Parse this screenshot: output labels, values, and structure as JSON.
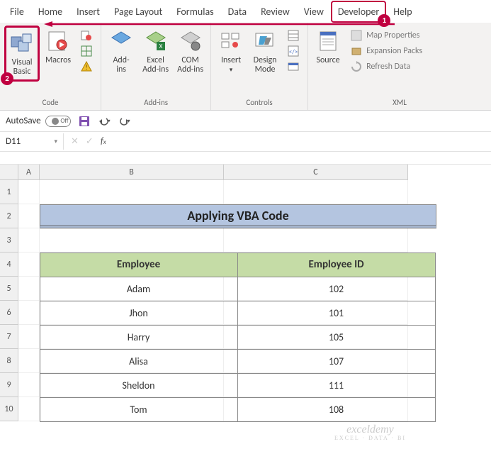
{
  "tabs": [
    "File",
    "Home",
    "Insert",
    "Page Layout",
    "Formulas",
    "Data",
    "Review",
    "View",
    "Developer",
    "Help"
  ],
  "active_tab": "Developer",
  "callouts": {
    "badge1": "1",
    "badge2": "2"
  },
  "ribbon": {
    "code": {
      "label": "Code",
      "visual_basic": "Visual\nBasic",
      "macros": "Macros"
    },
    "addins": {
      "label": "Add-ins",
      "addins": "Add-\nins",
      "excel_addins": "Excel\nAdd-ins",
      "com_addins": "COM\nAdd-ins"
    },
    "controls": {
      "label": "Controls",
      "insert": "Insert",
      "design_mode": "Design\nMode"
    },
    "xml": {
      "label": "XML",
      "source": "Source",
      "map_properties": "Map Properties",
      "expansion_packs": "Expansion Packs",
      "refresh_data": "Refresh Data"
    }
  },
  "qat": {
    "autosave_label": "AutoSave",
    "autosave_state": "Off"
  },
  "name_box": "D11",
  "formula_bar": "",
  "columns": [
    "A",
    "B",
    "C"
  ],
  "rows": [
    "1",
    "2",
    "3",
    "4",
    "5",
    "6",
    "7",
    "8",
    "9",
    "10"
  ],
  "title": "Applying VBA Code",
  "table": {
    "headers": [
      "Employee",
      "Employee ID"
    ],
    "data": [
      [
        "Adam",
        "102"
      ],
      [
        "Jhon",
        "101"
      ],
      [
        "Harry",
        "105"
      ],
      [
        "Alisa",
        "107"
      ],
      [
        "Sheldon",
        "111"
      ],
      [
        "Tom",
        "108"
      ]
    ]
  },
  "watermark": {
    "main": "exceldemy",
    "sub": "EXCEL · DATA · BI"
  }
}
